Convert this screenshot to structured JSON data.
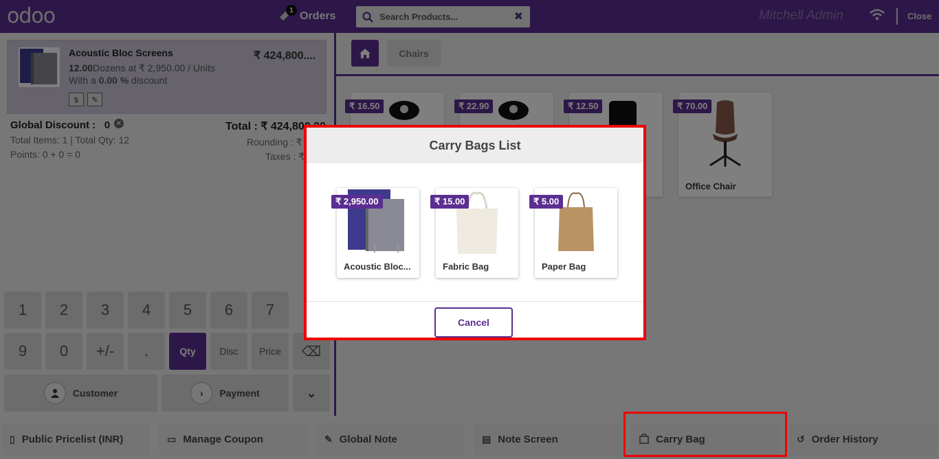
{
  "header": {
    "logo": "odoo",
    "orders_label": "Orders",
    "orders_badge": "1",
    "search_placeholder": "Search Products...",
    "clear_symbol": "✖",
    "user_name": "Mitchell Admin",
    "close_label": "Close"
  },
  "orderline": {
    "product_name": "Acoustic Bloc Screens",
    "price": "₹ 424,800....",
    "qty": "12.00",
    "qty_rest": "Dozens at ₹ 2,950.00 / Units",
    "discount_prefix": "With a ",
    "discount_value": "0.00 %",
    "discount_suffix": " discount"
  },
  "summary": {
    "global_discount_label": "Global Discount :",
    "global_discount_value": "0",
    "total": "Total : ₹ 424,800.00",
    "items_line": "Total Items: 1  |  Total Qty: 12",
    "points_line": "Points: 0 + 0 = 0",
    "rounding": "Rounding : ₹",
    "taxes": "Taxes : ₹"
  },
  "numpad": {
    "row1": [
      "1",
      "2",
      "3",
      "4",
      "5",
      "6",
      "7"
    ],
    "row2": [
      "9",
      "0",
      "+/-",
      ".",
      "Qty",
      "Disc",
      "Price"
    ],
    "backspace": "⌫",
    "customer": "Customer",
    "payment": "Payment",
    "more": "⌄"
  },
  "categories": {
    "current": "Chairs"
  },
  "products": [
    {
      "price": "₹ 16.50",
      "name": ""
    },
    {
      "price": "₹ 22.90",
      "name": ""
    },
    {
      "price": "₹ 12.50",
      "name": ""
    },
    {
      "price": "₹ 70.00",
      "name": "Office Chair"
    }
  ],
  "modal": {
    "title": "Carry Bags List",
    "bags": [
      {
        "price": "₹ 2,950.00",
        "name": "Acoustic Bloc..."
      },
      {
        "price": "₹ 15.00",
        "name": "Fabric Bag"
      },
      {
        "price": "₹ 5.00",
        "name": "Paper Bag"
      }
    ],
    "cancel": "Cancel"
  },
  "bottom_bar": [
    {
      "label": "Public Pricelist (INR)",
      "icon": "book-icon"
    },
    {
      "label": "Manage Coupon",
      "icon": "ticket-icon"
    },
    {
      "label": "Global Note",
      "icon": "edit-icon"
    },
    {
      "label": "Note Screen",
      "icon": "comments-icon"
    },
    {
      "label": "Carry Bag",
      "icon": "shopping-bag-icon"
    },
    {
      "label": "Order History",
      "icon": "history-icon"
    }
  ],
  "colors": {
    "brand": "#5b2e91",
    "highlight": "#ee0000"
  }
}
